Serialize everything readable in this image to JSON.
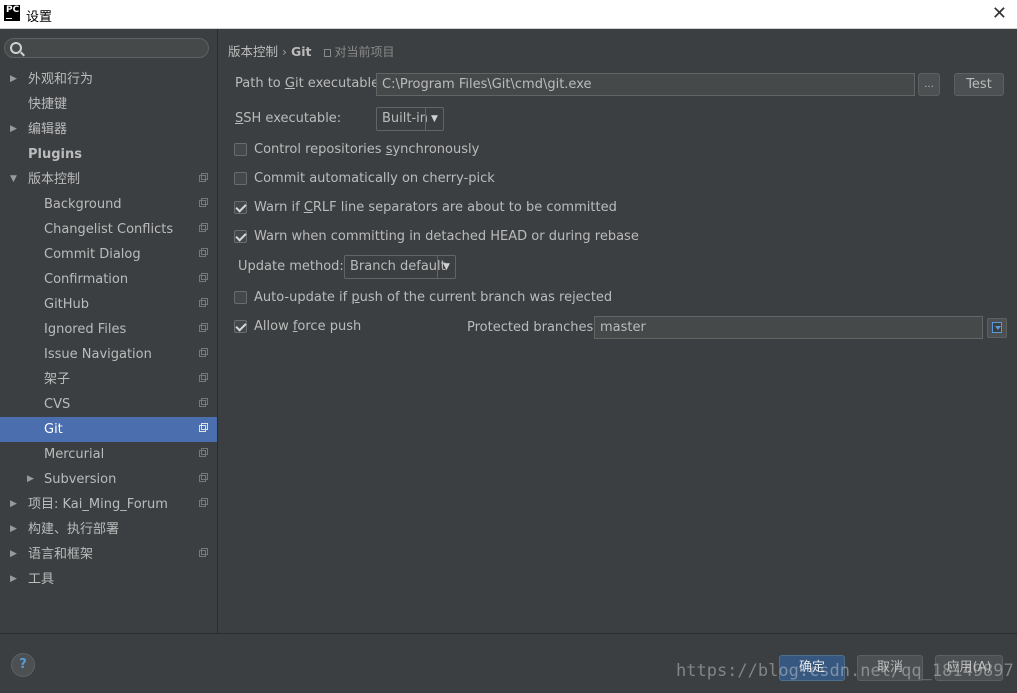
{
  "window": {
    "title": "设置",
    "app_icon_text": "PC"
  },
  "search": {
    "placeholder": ""
  },
  "tree": [
    {
      "label": "外观和行为",
      "arrow": "▶",
      "level": 0,
      "bold": false,
      "icon": false
    },
    {
      "label": "快捷键",
      "arrow": "",
      "level": 0,
      "bold": false,
      "icon": false
    },
    {
      "label": "编辑器",
      "arrow": "▶",
      "level": 0,
      "bold": false,
      "icon": false
    },
    {
      "label": "Plugins",
      "arrow": "",
      "level": 0,
      "bold": true,
      "icon": false
    },
    {
      "label": "版本控制",
      "arrow": "▼",
      "level": 0,
      "bold": false,
      "icon": true
    },
    {
      "label": "Background",
      "arrow": "",
      "level": 1,
      "icon": true
    },
    {
      "label": "Changelist Conflicts",
      "arrow": "",
      "level": 1,
      "icon": true
    },
    {
      "label": "Commit Dialog",
      "arrow": "",
      "level": 1,
      "icon": true
    },
    {
      "label": "Confirmation",
      "arrow": "",
      "level": 1,
      "icon": true
    },
    {
      "label": "GitHub",
      "arrow": "",
      "level": 1,
      "icon": true
    },
    {
      "label": "Ignored Files",
      "arrow": "",
      "level": 1,
      "icon": true
    },
    {
      "label": "Issue Navigation",
      "arrow": "",
      "level": 1,
      "icon": true
    },
    {
      "label": "架子",
      "arrow": "",
      "level": 1,
      "icon": true
    },
    {
      "label": "CVS",
      "arrow": "",
      "level": 1,
      "icon": true
    },
    {
      "label": "Git",
      "arrow": "",
      "level": 1,
      "icon": true,
      "selected": true
    },
    {
      "label": "Mercurial",
      "arrow": "",
      "level": 1,
      "icon": true
    },
    {
      "label": "Subversion",
      "arrow": "▶",
      "level": 1,
      "icon": true
    },
    {
      "label": "项目: Kai_Ming_Forum",
      "arrow": "▶",
      "level": 0,
      "bold": false,
      "icon": true
    },
    {
      "label": "构建、执行部署",
      "arrow": "▶",
      "level": 0,
      "bold": false,
      "icon": false
    },
    {
      "label": "语言和框架",
      "arrow": "▶",
      "level": 0,
      "bold": false,
      "icon": true
    },
    {
      "label": "工具",
      "arrow": "▶",
      "level": 0,
      "bold": false,
      "icon": false
    }
  ],
  "breadcrumb": {
    "parent": "版本控制",
    "separator": "›",
    "current": "Git",
    "scope": "对当前项目"
  },
  "git": {
    "path_label_pre": "Path to ",
    "path_label_u": "G",
    "path_label_post": "it executable:",
    "path_value": "C:\\Program Files\\Git\\cmd\\git.exe",
    "browse_label": "...",
    "test_label": "Test",
    "ssh_label_u": "S",
    "ssh_label_post": "SH executable:",
    "ssh_value": "Built-in",
    "update_method_label": "Update method:",
    "update_method_value": "Branch default",
    "protected_label": "Protected branches:",
    "protected_value": "master",
    "dropdown_glyph": "▼"
  },
  "options": [
    {
      "pre": "Control repositories ",
      "u": "s",
      "post": "ynchronously",
      "checked": false
    },
    {
      "pre": "Commit automatically on cherry-pick",
      "u": "",
      "post": "",
      "checked": false
    },
    {
      "pre": "Warn if ",
      "u": "C",
      "post": "RLF line separators are about to be committed",
      "checked": true
    },
    {
      "pre": "Warn when committing in detached HEAD or during rebase",
      "u": "",
      "post": "",
      "checked": true
    },
    {
      "pre": "Auto-update if ",
      "u": "p",
      "post": "ush of the current branch was rejected",
      "checked": false
    },
    {
      "pre": "Allow ",
      "u": "f",
      "post": "orce push",
      "checked": true
    }
  ],
  "footer": {
    "help": "?",
    "ok": "确定",
    "cancel": "取消",
    "apply": "应用(A)",
    "watermark": "https://blog.csdn.net/qq_18149897"
  },
  "colors": {
    "selection": "#4b6eaf",
    "background": "#3c3f41",
    "primary_button": "#365880"
  }
}
